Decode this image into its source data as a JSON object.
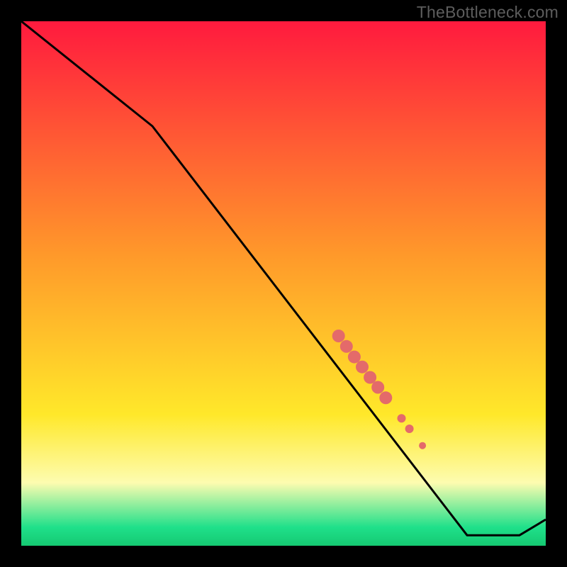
{
  "watermark": "TheBottleneck.com",
  "colors": {
    "red": "#ff1a3e",
    "orange": "#ff9a2a",
    "yellow": "#ffe82a",
    "pale_yellow": "#fdfcb0",
    "green": "#1fe08a",
    "line": "#000000",
    "marker": "#e46a6a",
    "background": "#000000"
  },
  "chart_data": {
    "type": "line",
    "title": "",
    "xlabel": "",
    "ylabel": "",
    "xlim": [
      0,
      100
    ],
    "ylim": [
      0,
      100
    ],
    "series": [
      {
        "name": "curve",
        "x": [
          0,
          25,
          85,
          95,
          100
        ],
        "y": [
          100,
          80,
          2,
          2,
          5
        ]
      }
    ],
    "markers": {
      "name": "highlighted-segment",
      "points": [
        {
          "x": 60.5,
          "y": 40.0,
          "size": 9
        },
        {
          "x": 62.0,
          "y": 38.0,
          "size": 9
        },
        {
          "x": 63.5,
          "y": 36.0,
          "size": 9
        },
        {
          "x": 65.0,
          "y": 34.1,
          "size": 9
        },
        {
          "x": 66.5,
          "y": 32.1,
          "size": 9
        },
        {
          "x": 68.0,
          "y": 30.2,
          "size": 9
        },
        {
          "x": 69.5,
          "y": 28.2,
          "size": 9
        },
        {
          "x": 72.5,
          "y": 24.3,
          "size": 6
        },
        {
          "x": 74.0,
          "y": 22.3,
          "size": 6
        },
        {
          "x": 76.5,
          "y": 19.1,
          "size": 5
        }
      ]
    },
    "gradient_stops": [
      {
        "offset": 0.0,
        "color": "#ff1a3e"
      },
      {
        "offset": 0.45,
        "color": "#ff9a2a"
      },
      {
        "offset": 0.75,
        "color": "#ffe82a"
      },
      {
        "offset": 0.88,
        "color": "#fdfcb0"
      },
      {
        "offset": 0.965,
        "color": "#1fe08a"
      },
      {
        "offset": 1.0,
        "color": "#15c972"
      }
    ]
  }
}
